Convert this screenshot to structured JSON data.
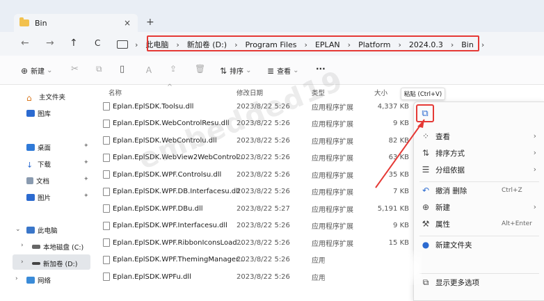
{
  "tab": {
    "title": "Bin",
    "close": "×",
    "new": "+"
  },
  "nav": {
    "back": "←",
    "forward": "→",
    "up": "↑",
    "refresh": "C"
  },
  "breadcrumb": [
    "此电脑",
    "新加卷 (D:)",
    "Program Files",
    "EPLAN",
    "Platform",
    "2024.0.3",
    "Bin"
  ],
  "toolbar": {
    "new": "新建",
    "sort": "排序",
    "view": "查看",
    "more": "···"
  },
  "sidebar": {
    "home": "主文件夹",
    "gallery": "图库",
    "desktop": "桌面",
    "downloads": "下载",
    "documents": "文档",
    "pictures": "图片",
    "this_pc": "此电脑",
    "drive_c": "本地磁盘 (C:)",
    "drive_d": "新加卷 (D:)",
    "network": "网络"
  },
  "columns": {
    "name": "名称",
    "date": "修改日期",
    "type": "类型",
    "size": "大小"
  },
  "files": [
    {
      "name": "Eplan.EplSDK.Toolsu.dll",
      "date": "2023/8/22 5:26",
      "type": "应用程序扩展",
      "size": "4,337 KB"
    },
    {
      "name": "Eplan.EplSDK.WebControlResu.dll",
      "date": "2023/8/22 5:26",
      "type": "应用程序扩展",
      "size": "9 KB"
    },
    {
      "name": "Eplan.EplSDK.WebControlu.dll",
      "date": "2023/8/22 5:26",
      "type": "应用程序扩展",
      "size": "82 KB"
    },
    {
      "name": "Eplan.EplSDK.WebView2WebControl...",
      "date": "2023/8/22 5:26",
      "type": "应用程序扩展",
      "size": "63 KB"
    },
    {
      "name": "Eplan.EplSDK.WPF.Controlsu.dll",
      "date": "2023/8/22 5:26",
      "type": "应用程序扩展",
      "size": "35 KB"
    },
    {
      "name": "Eplan.EplSDK.WPF.DB.Interfacesu.dll",
      "date": "2023/8/22 5:26",
      "type": "应用程序扩展",
      "size": "7 KB"
    },
    {
      "name": "Eplan.EplSDK.WPF.DBu.dll",
      "date": "2023/8/22 5:27",
      "type": "应用程序扩展",
      "size": "5,191 KB"
    },
    {
      "name": "Eplan.EplSDK.WPF.Interfacesu.dll",
      "date": "2023/8/22 5:26",
      "type": "应用程序扩展",
      "size": "9 KB"
    },
    {
      "name": "Eplan.EplSDK.WPF.RibbonIconsLoad...",
      "date": "2023/8/22 5:26",
      "type": "应用程序扩展",
      "size": "15 KB"
    },
    {
      "name": "Eplan.EplSDK.WPF.ThemingManager...",
      "date": "2023/8/22 5:26",
      "type": "应用",
      "size": ""
    },
    {
      "name": "Eplan.EplSDK.WPFu.dll",
      "date": "2023/8/22 5:26",
      "type": "应用",
      "size": ""
    }
  ],
  "tooltip": "粘贴 (Ctrl+V)",
  "context_menu": {
    "view": "查看",
    "sort": "排序方式",
    "group": "分组依据",
    "undo": "撤消 删除",
    "undo_shortcut": "Ctrl+Z",
    "new": "新建",
    "properties": "属性",
    "properties_shortcut": "Alt+Enter",
    "new_folder": "新建文件夹",
    "more_options": "显示更多选项"
  },
  "watermark": "embedded19",
  "accent": "#e53935"
}
